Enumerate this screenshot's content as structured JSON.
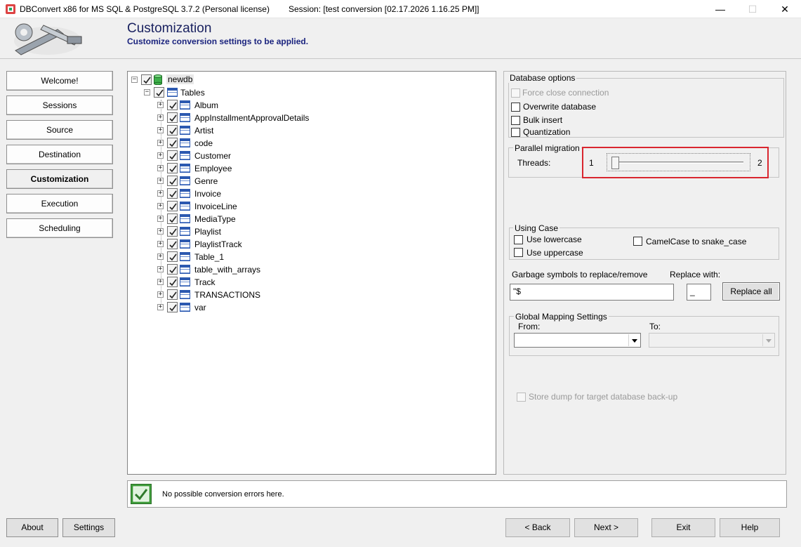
{
  "window": {
    "title": "DBConvert x86 for MS SQL & PostgreSQL 3.7.2 (Personal license)",
    "session": "Session: [test conversion [02.17.2026 1.16.25 PM]]",
    "minimize_glyph": "—",
    "maximize_glyph": "☐",
    "close_glyph": "✕"
  },
  "header": {
    "title": "Customization",
    "subtitle": "Customize conversion settings to be applied."
  },
  "nav": [
    {
      "label": "Welcome!",
      "active": false
    },
    {
      "label": "Sessions",
      "active": false
    },
    {
      "label": "Source",
      "active": false
    },
    {
      "label": "Destination",
      "active": false
    },
    {
      "label": "Customization",
      "active": true
    },
    {
      "label": "Execution",
      "active": false
    },
    {
      "label": "Scheduling",
      "active": false
    }
  ],
  "tree": {
    "database": "newdb",
    "group": "Tables",
    "tables": [
      "Album",
      "AppInstallmentApprovalDetails",
      "Artist",
      "code",
      "Customer",
      "Employee",
      "Genre",
      "Invoice",
      "InvoiceLine",
      "MediaType",
      "Playlist",
      "PlaylistTrack",
      "Table_1",
      "table_with_arrays",
      "Track",
      "TRANSACTIONS",
      "var"
    ]
  },
  "database_options": {
    "title": "Database options",
    "force_close": {
      "label": "Force close connection",
      "checked": false,
      "enabled": false
    },
    "overwrite": {
      "label": "Overwrite database",
      "checked": false
    },
    "bulk_insert": {
      "label": "Bulk insert",
      "checked": false
    },
    "quantization": {
      "label": "Quantization",
      "checked": false
    }
  },
  "parallel": {
    "title": "Parallel migration",
    "threads_label": "Threads:",
    "min": "1",
    "max": "2",
    "value": 1
  },
  "using_case": {
    "title": "Using Case",
    "lowercase": {
      "label": "Use lowercase",
      "checked": false
    },
    "uppercase": {
      "label": "Use uppercase",
      "checked": false
    },
    "camelcase": {
      "label": "CamelCase to snake_case",
      "checked": false
    }
  },
  "garbage": {
    "label": "Garbage symbols to replace/remove",
    "value": "\"$",
    "replace_label": "Replace with:",
    "replace_value": "_",
    "replace_all": "Replace all"
  },
  "global_mapping": {
    "title": "Global Mapping Settings",
    "from_label": "From:",
    "to_label": "To:",
    "from_value": "",
    "to_value": ""
  },
  "store_dump": {
    "label": "Store dump for target database back-up",
    "checked": false,
    "enabled": false
  },
  "status": {
    "text": "No possible conversion errors here."
  },
  "footer": {
    "about": "About",
    "settings": "Settings",
    "back": "< Back",
    "next": "Next >",
    "exit": "Exit",
    "help": "Help"
  },
  "colors": {
    "highlight": "#d9262f",
    "title": "#1a237e",
    "table_icon": "#2c59b0",
    "status_ok": "#3e9d3a"
  }
}
